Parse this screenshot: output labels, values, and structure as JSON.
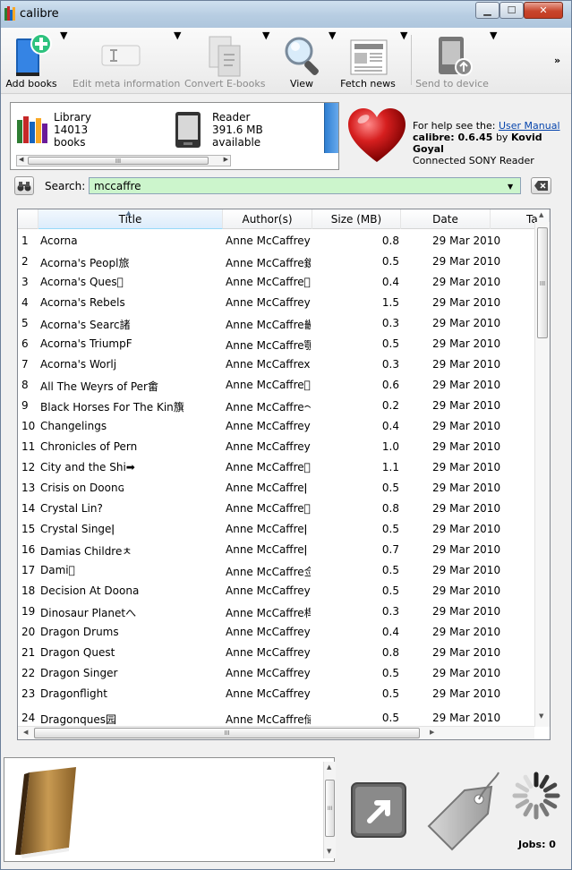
{
  "window": {
    "title": "calibre",
    "minimize": "▁",
    "maximize": "☐",
    "close": "✕"
  },
  "toolbar": {
    "add_books": "Add books",
    "edit_meta": "Edit meta information",
    "convert": "Convert E-books",
    "view": "View",
    "fetch_news": "Fetch news",
    "send_to_device": "Send to device",
    "more": "»",
    "dropdown_arrow": "▼"
  },
  "devices": {
    "library": {
      "name": "Library",
      "count": "14013",
      "unit": "books"
    },
    "reader": {
      "name": "Reader",
      "size": "391.6 MB",
      "status": "available"
    },
    "scroll_grip": "III"
  },
  "help": {
    "prefix": "For help see the: ",
    "link": "User Manual",
    "version": "calibre: 0.6.45",
    "by": " by ",
    "author": "Kovid Goyal",
    "connected": "Connected SONY Reader"
  },
  "search": {
    "label": "Search:",
    "value": "mccaffre",
    "drop": "▼"
  },
  "table": {
    "headers": [
      "Title",
      "Author(s)",
      "Size (MB)",
      "Date",
      "Ta"
    ],
    "sort_indicator": "▲",
    "rows": [
      {
        "n": "1",
        "title": "Acorna",
        "author": "Anne McCaffrey",
        "size": "0.8",
        "date": "29 Mar 2010"
      },
      {
        "n": "2",
        "title": "Acorna's Peopl旅",
        "author": "Anne McCaffre鏡",
        "size": "0.5",
        "date": "29 Mar 2010"
      },
      {
        "n": "3",
        "title": "Acorna's Ques\u0000",
        "author": "Anne McCaffre\u0000",
        "size": "0.4",
        "date": "29 Mar 2010"
      },
      {
        "n": "4",
        "title": "Acorna's Rebels",
        "author": "Anne McCaffrey",
        "size": "1.5",
        "date": "29 Mar 2010"
      },
      {
        "n": "5",
        "title": "Acorna's Searc諸",
        "author": "Anne McCaffre畿",
        "size": "0.3",
        "date": "29 Mar 2010"
      },
      {
        "n": "6",
        "title": "Acorna's TriumpF",
        "author": "Anne McCaffre顎",
        "size": "0.5",
        "date": "29 Mar 2010"
      },
      {
        "n": "7",
        "title": "Acorna's Worlj",
        "author": "Anne McCaffrex",
        "size": "0.3",
        "date": "29 Mar 2010"
      },
      {
        "n": "8",
        "title": "All The Weyrs of Per畬",
        "author": "Anne McCaffre\u0000",
        "size": "0.6",
        "date": "29 Mar 2010"
      },
      {
        "n": "9",
        "title": "Black Horses For The Kin籏",
        "author": "Anne McCaffre〜",
        "size": "0.2",
        "date": "29 Mar 2010"
      },
      {
        "n": "10",
        "title": "Changelings",
        "author": "Anne McCaffrey",
        "size": "0.4",
        "date": "29 Mar 2010"
      },
      {
        "n": "11",
        "title": "Chronicles of Pern",
        "author": "Anne McCaffrey",
        "size": "1.0",
        "date": "29 Mar 2010"
      },
      {
        "n": "12",
        "title": "City and the Shi➡",
        "author": "Anne McCaffre\u0000",
        "size": "1.1",
        "date": "29 Mar 2010"
      },
      {
        "n": "13",
        "title": "Crisis on Doonɢ",
        "author": "Anne McCaffreǀ",
        "size": "0.5",
        "date": "29 Mar 2010"
      },
      {
        "n": "14",
        "title": "Crystal Lin?",
        "author": "Anne McCaffre\u0000",
        "size": "0.8",
        "date": "29 Mar 2010"
      },
      {
        "n": "15",
        "title": "Crystal Singeǀ",
        "author": "Anne McCaffreǀ",
        "size": "0.5",
        "date": "29 Mar 2010"
      },
      {
        "n": "16",
        "title": "Damias Childreㅊ",
        "author": "Anne McCaffreǀ",
        "size": "0.7",
        "date": "29 Mar 2010"
      },
      {
        "n": "17",
        "title": "Dami\u0000",
        "author": "Anne McCaffre佥",
        "size": "0.5",
        "date": "29 Mar 2010"
      },
      {
        "n": "18",
        "title": "Decision At Doona",
        "author": "Anne McCaffrey",
        "size": "0.5",
        "date": "29 Mar 2010"
      },
      {
        "n": "19",
        "title": "Dinosaur Planetへ",
        "author": "Anne McCaffre桿",
        "size": "0.3",
        "date": "29 Mar 2010"
      },
      {
        "n": "20",
        "title": "Dragon Drums",
        "author": "Anne McCaffrey",
        "size": "0.4",
        "date": "29 Mar 2010"
      },
      {
        "n": "21",
        "title": "Dragon Quest",
        "author": "Anne McCaffrey",
        "size": "0.8",
        "date": "29 Mar 2010"
      },
      {
        "n": "22",
        "title": "Dragon Singer",
        "author": "Anne McCaffrey",
        "size": "0.5",
        "date": "29 Mar 2010"
      },
      {
        "n": "23",
        "title": "Dragonflight",
        "author": "Anne McCaffrey",
        "size": "0.5",
        "date": "29 Mar 2010"
      },
      {
        "n": "24",
        "title": "Dragonques园",
        "author": "Anne McCaffre储",
        "size": "0.5",
        "date": "29 Mar 2010"
      }
    ],
    "scroll_grip": "III"
  },
  "jobs": {
    "label": "Jobs: 0"
  }
}
